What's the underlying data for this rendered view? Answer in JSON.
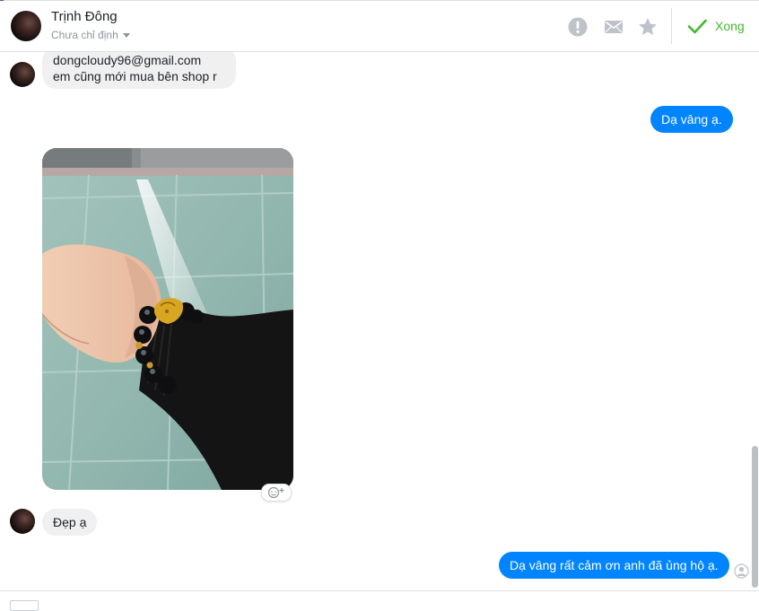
{
  "header": {
    "contact_name": "Trịnh Đông",
    "status_label": "Chưa chỉ định",
    "done_label": "Xong",
    "icons": [
      "spam-report-icon",
      "unread-envelope-icon",
      "star-icon",
      "checkmark-icon"
    ]
  },
  "messages": {
    "m1_line1": "dongcloudy96@gmail.com",
    "m1_line2": "em cũng mới  mua bên shop r",
    "m2": "Dạ vâng ạ.",
    "m4": "Đẹp ạ",
    "m5": "Dạ vâng rất cảm ơn anh đã ủng hộ ạ."
  },
  "colors": {
    "outgoing_bubble": "#0084ff",
    "incoming_bubble": "#f1f0f0",
    "done_green": "#42b72a",
    "icon_gray": "#bec2c9"
  }
}
